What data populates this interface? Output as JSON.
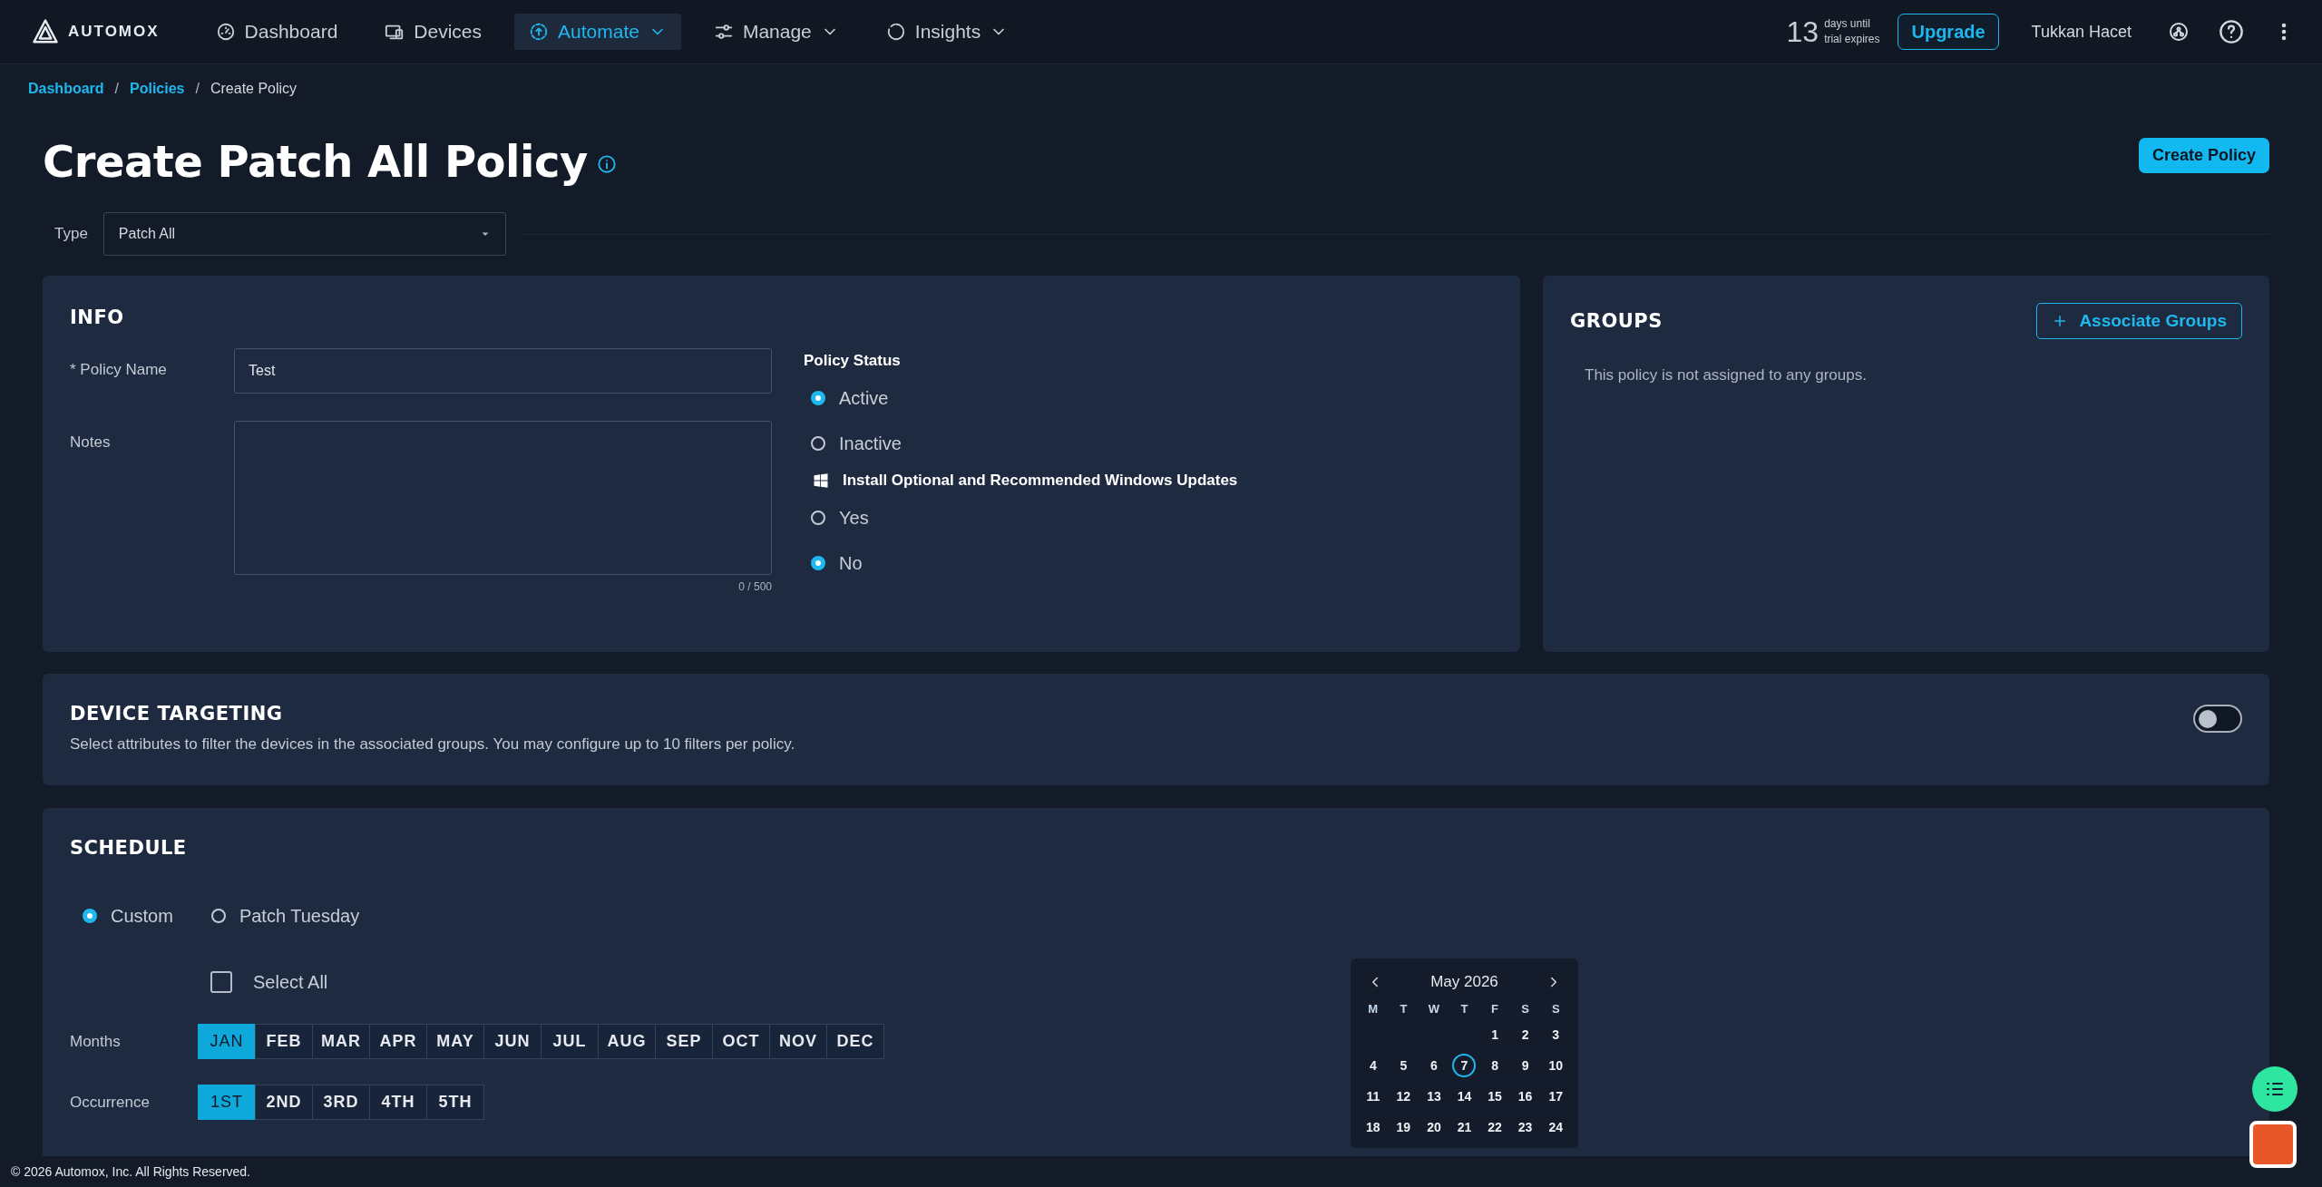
{
  "nav": {
    "logo": "AUTOMOX",
    "items": [
      {
        "label": "Dashboard",
        "kind": "gauge",
        "selected": false,
        "has_menu": false
      },
      {
        "label": "Devices",
        "kind": "devices",
        "selected": false,
        "has_menu": false
      },
      {
        "label": "Automate",
        "kind": "automate",
        "selected": true,
        "has_menu": true
      },
      {
        "label": "Manage",
        "kind": "sliders",
        "selected": false,
        "has_menu": true
      },
      {
        "label": "Insights",
        "kind": "ring",
        "selected": false,
        "has_menu": true
      }
    ],
    "trial": {
      "days": "13",
      "line_1": "days until",
      "line_2": "trial expires"
    },
    "upgrade": "Upgrade",
    "user": "Tukkan Hacet"
  },
  "breadcrumb": [
    {
      "label": "Dashboard",
      "kind": "link"
    },
    {
      "label": "/",
      "kind": "separator"
    },
    {
      "label": "Policies",
      "kind": "link"
    },
    {
      "label": "/",
      "kind": "separator"
    },
    {
      "label": "Create Policy",
      "kind": "current"
    }
  ],
  "page": {
    "title": "Create Patch All Policy",
    "create_button": "Create Policy"
  },
  "type_field": {
    "label": "Type",
    "value": "Patch All"
  },
  "info": {
    "heading": "INFO",
    "policy_name": {
      "label": "* Policy Name",
      "value": "Test"
    },
    "notes": {
      "label": "Notes",
      "counter": "0 / 500"
    },
    "status": {
      "heading": "Policy Status",
      "options": [
        {
          "label": "Active",
          "selected": true
        },
        {
          "label": "Inactive",
          "selected": false
        }
      ]
    },
    "windows": {
      "heading": "Install Optional and Recommended Windows Updates",
      "options": [
        {
          "label": "Yes",
          "selected": false
        },
        {
          "label": "No",
          "selected": true
        }
      ]
    }
  },
  "groups": {
    "heading": "GROUPS",
    "button": "Associate Groups",
    "empty_text": "This policy is not assigned to any groups."
  },
  "device_targeting": {
    "heading": "DEVICE TARGETING",
    "description": "Select attributes to filter the devices in the associated groups. You may configure up to 10 filters per policy.",
    "on": false
  },
  "schedule": {
    "heading": "SCHEDULE",
    "modes": [
      {
        "label": "Custom",
        "selected": true
      },
      {
        "label": "Patch Tuesday",
        "selected": false
      }
    ],
    "select_all": {
      "label": "Select All",
      "checked": false
    },
    "months": {
      "label": "Months",
      "items": [
        {
          "label": "JAN",
          "selected": true
        },
        {
          "label": "FEB",
          "selected": false
        },
        {
          "label": "MAR",
          "selected": false
        },
        {
          "label": "APR",
          "selected": false
        },
        {
          "label": "MAY",
          "selected": false
        },
        {
          "label": "JUN",
          "selected": false
        },
        {
          "label": "JUL",
          "selected": false
        },
        {
          "label": "AUG",
          "selected": false
        },
        {
          "label": "SEP",
          "selected": false
        },
        {
          "label": "OCT",
          "selected": false
        },
        {
          "label": "NOV",
          "selected": false
        },
        {
          "label": "DEC",
          "selected": false
        }
      ]
    },
    "occurrence": {
      "label": "Occurrence",
      "items": [
        {
          "label": "1ST",
          "selected": true
        },
        {
          "label": "2ND",
          "selected": false
        },
        {
          "label": "3RD",
          "selected": false
        },
        {
          "label": "4TH",
          "selected": false
        },
        {
          "label": "5TH",
          "selected": false
        }
      ]
    },
    "calendar": {
      "title": "May 2026",
      "weekdays": [
        "M",
        "T",
        "W",
        "T",
        "F",
        "S",
        "S"
      ],
      "weeks": [
        [
          {
            "label": "1",
            "marked": false
          },
          {
            "label": "2",
            "marked": false
          },
          {
            "label": "3",
            "marked": false
          }
        ],
        [
          {
            "label": "4",
            "marked": false
          },
          {
            "label": "5",
            "marked": false
          },
          {
            "label": "6",
            "marked": false
          },
          {
            "label": "7",
            "marked": true
          },
          {
            "label": "8",
            "marked": false
          },
          {
            "label": "9",
            "marked": false
          },
          {
            "label": "10",
            "marked": false
          }
        ],
        [
          {
            "label": "11",
            "marked": false
          },
          {
            "label": "12",
            "marked": false
          },
          {
            "label": "13",
            "marked": false
          },
          {
            "label": "14",
            "marked": false
          },
          {
            "label": "15",
            "marked": false
          },
          {
            "label": "16",
            "marked": false
          },
          {
            "label": "17",
            "marked": false
          }
        ],
        [
          {
            "label": "18",
            "marked": false
          },
          {
            "label": "19",
            "marked": false
          },
          {
            "label": "20",
            "marked": false
          },
          {
            "label": "21",
            "marked": false
          },
          {
            "label": "22",
            "marked": false
          },
          {
            "label": "23",
            "marked": false
          },
          {
            "label": "24",
            "marked": false
          }
        ]
      ]
    }
  },
  "footer": "© 2026 Automox, Inc. All Rights Reserved."
}
